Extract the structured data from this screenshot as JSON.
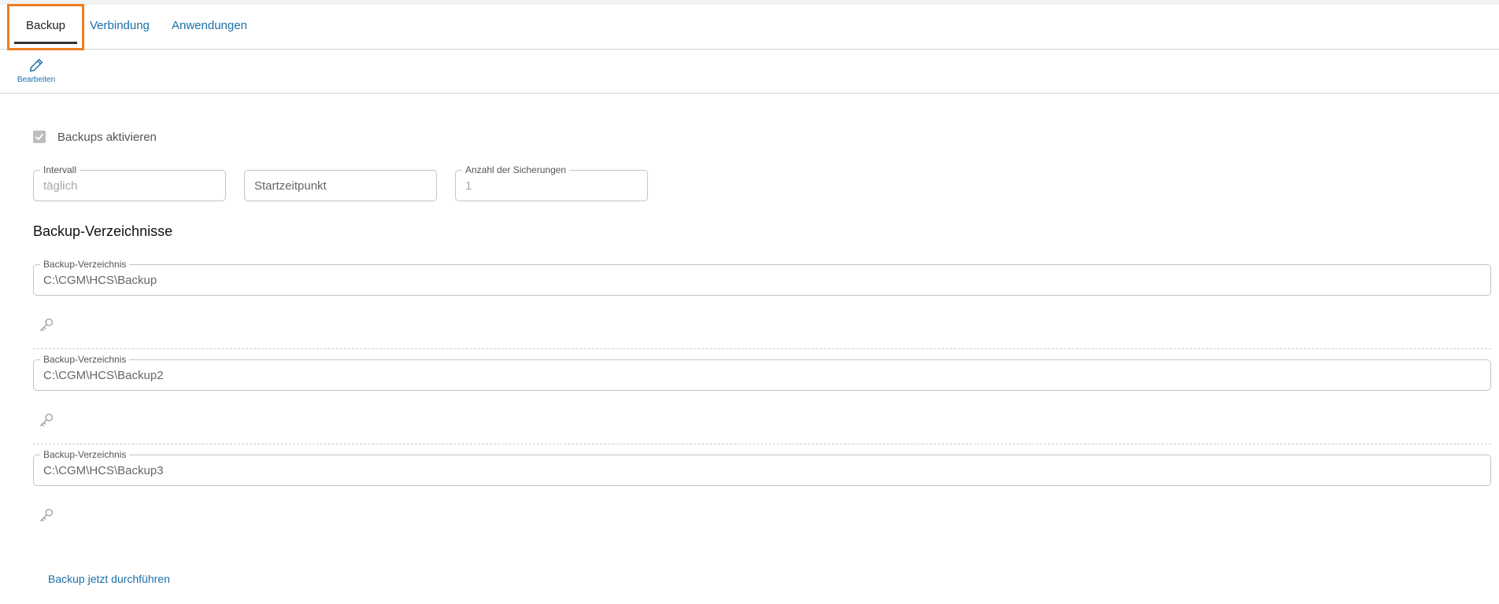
{
  "tabs": [
    {
      "label": "Backup"
    },
    {
      "label": "Verbindung"
    },
    {
      "label": "Anwendungen"
    }
  ],
  "toolbar": {
    "edit_label": "Bearbeiten",
    "edit_icon": "pencil-icon"
  },
  "settings": {
    "enable_backups": {
      "label": "Backups aktivieren",
      "checked": true
    },
    "interval": {
      "label": "Intervall",
      "value": "täglich"
    },
    "start_time": {
      "placeholder": "Startzeitpunkt"
    },
    "count": {
      "label": "Anzahl der Sicherungen",
      "value": "1"
    }
  },
  "directories": {
    "title": "Backup-Verzeichnisse",
    "items": [
      {
        "label": "Backup-Verzeichnis",
        "value": "C:\\CGM\\HCS\\Backup",
        "icon": "key-icon"
      },
      {
        "label": "Backup-Verzeichnis",
        "value": "C:\\CGM\\HCS\\Backup2",
        "icon": "key-icon"
      },
      {
        "label": "Backup-Verzeichnis",
        "value": "C:\\CGM\\HCS\\Backup3",
        "icon": "key-icon"
      }
    ]
  },
  "actions": {
    "run_backup": "Backup jetzt durchführen"
  },
  "colors": {
    "accent": "#1a6fa8",
    "focus": "#ee7d21",
    "disabled": "#bdbdbd"
  }
}
